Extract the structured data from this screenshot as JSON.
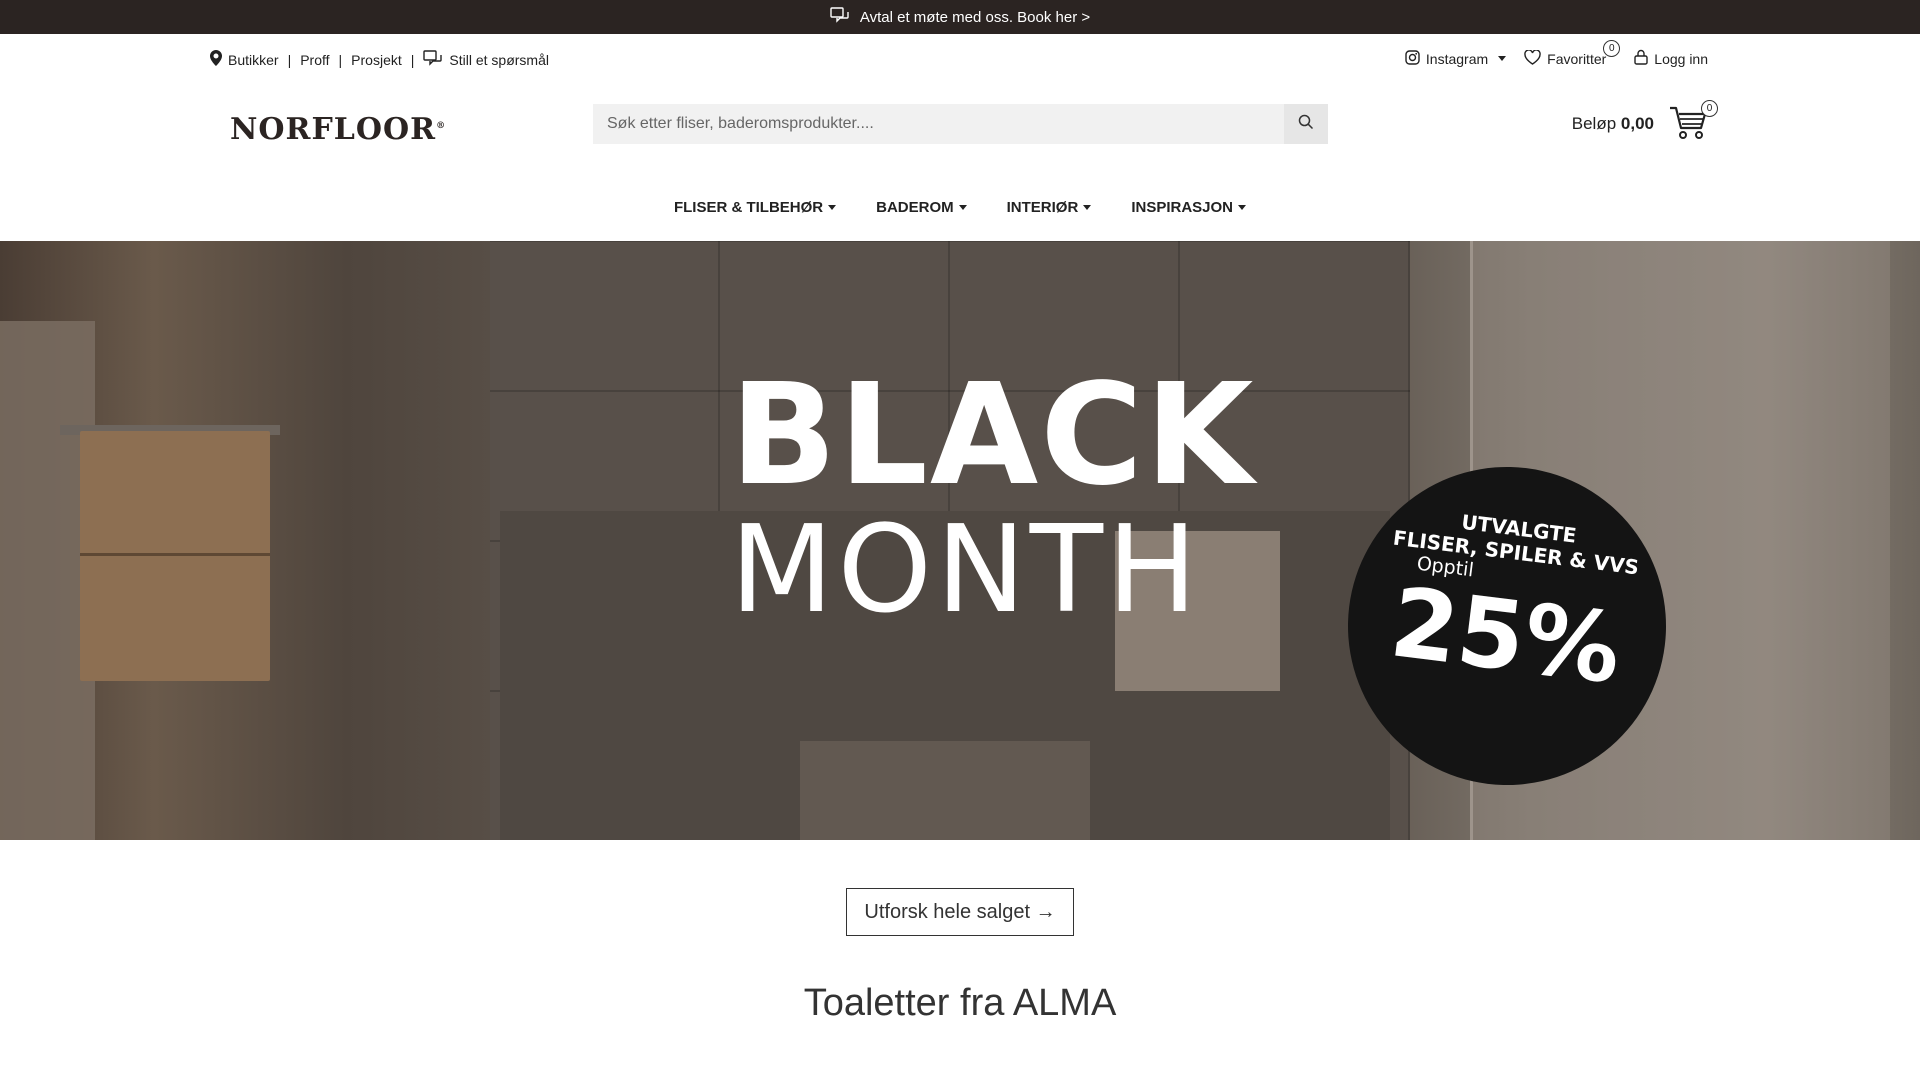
{
  "announcement": {
    "text": "Avtal et møte med oss. Book her >",
    "icon": "chat-icon"
  },
  "utility_left": [
    {
      "label": "Butikker",
      "icon": "map-pin-icon"
    },
    {
      "label": "Proff"
    },
    {
      "label": "Prosjekt"
    },
    {
      "label": "Still et spørsmål",
      "icon": "chat-icon"
    }
  ],
  "utility_right": {
    "instagram": "Instagram",
    "favorites": "Favoritter",
    "favorites_count": "0",
    "login": "Logg inn"
  },
  "logo": {
    "text": "NORFLOOR",
    "mark": "®"
  },
  "search": {
    "placeholder": "Søk etter fliser, baderomsprodukter...."
  },
  "cart": {
    "label": "Beløp",
    "amount": "0,00",
    "count": "0"
  },
  "nav": [
    {
      "label": "FLISER & TILBEHØR"
    },
    {
      "label": "BADEROM"
    },
    {
      "label": "INTERIØR"
    },
    {
      "label": "INSPIRASJON"
    }
  ],
  "hero": {
    "line1": "BLACK",
    "line2": "MONTH",
    "badge_line1": "UTVALGTE",
    "badge_line2": "FLISER, SPILER & VVS",
    "badge_line3": "Opptil",
    "badge_percent": "25%"
  },
  "cta": {
    "label": "Utforsk hele salget →"
  },
  "section_title": "Toaletter fra ALMA",
  "colors": {
    "announce_bg": "#2b2422",
    "accent_dark": "#141414"
  }
}
